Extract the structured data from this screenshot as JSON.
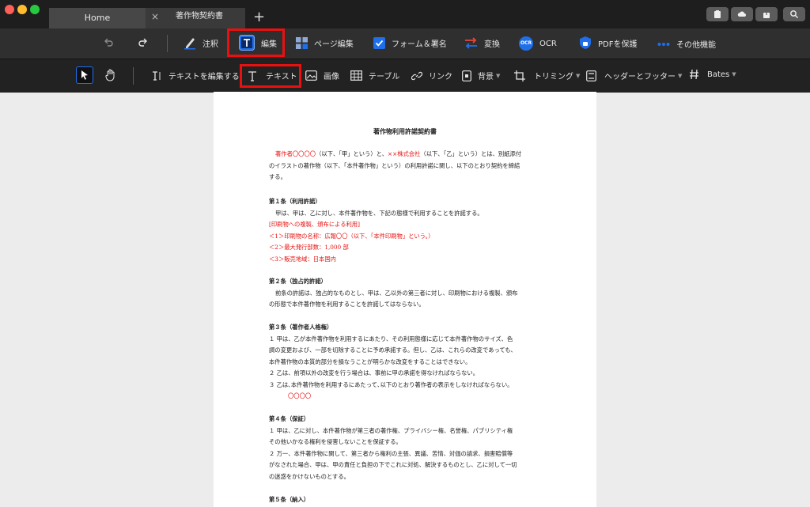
{
  "window": {
    "tabs": [
      {
        "label": "Home"
      },
      {
        "label": "著作物契約書"
      }
    ],
    "close_tab_glyph": "×",
    "add_tab_glyph": "+"
  },
  "main_toolbar": {
    "undo": "undo-icon",
    "redo": "redo-icon",
    "items": [
      {
        "label": "注釈"
      },
      {
        "label": "編集"
      },
      {
        "label": "ページ編集"
      },
      {
        "label": "フォーム＆署名"
      },
      {
        "label": "変換"
      },
      {
        "label": "OCR"
      },
      {
        "label": "PDFを保護"
      },
      {
        "label": "その他機能"
      }
    ],
    "ocr_badge": "OCR"
  },
  "edit_toolbar": {
    "items": [
      {
        "label": "テキストを編集する"
      },
      {
        "label": "テキスト"
      },
      {
        "label": "画像"
      },
      {
        "label": "テーブル"
      },
      {
        "label": "リンク"
      },
      {
        "label": "背景"
      },
      {
        "label": "トリミング"
      },
      {
        "label": "ヘッダーとフッター"
      },
      {
        "label": "Bates"
      }
    ]
  },
  "colors": {
    "highlight": "#e8110f",
    "accent_blue": "#1f6feb"
  },
  "document": {
    "title": "著作物利用許諾契約書",
    "intro": {
      "l1_a": "著作者〇〇〇〇",
      "l1_b": "（以下、「甲」という）と、",
      "l1_c": "××株式会社",
      "l1_d": "（以下、「乙」という）とは、別紙添付",
      "l2": "のイラストの著作物（以下、「本件著作物」という）の利用許諾に関し、以下のとおり契約を締結",
      "l3": "する。"
    },
    "art1": {
      "heading": "第１条（利用許諾）",
      "l1": "甲は、甲は、乙に対し、本件著作物を、下記の態様で利用することを許諾する。",
      "l2": "[印刷物への複製、頒布による利用]",
      "l3": "＜1＞印刷物の名称：広報〇〇（以下、「本件印刷物」という。）",
      "l4": "＜2＞最大発行部数：1,000 部",
      "l5": "＜3＞販売地域：日本国内"
    },
    "art2": {
      "heading": "第２条（独占的許諾）",
      "l1": "前条の許諾は、独占的なものとし、甲は、乙以外の第三者に対し、印刷物における複製、頒布",
      "l2": "の形態で本件著作物を利用することを許諾してはならない。"
    },
    "art3": {
      "heading": "第３条（著作者人格権）",
      "l1": "１ 甲は、乙が本件著作物を利用するにあたり、その利用態様に応じて本件著作物のサイズ、色",
      "l2": "調の変更および、一部を切除することに予め承諾する。但し、乙は、これらの改変であっても、",
      "l3": "本件著作物の本質的部分を損なうことが明らかな改変をすることはできない。",
      "l4": "２ 乙は、前項以外の改変を行う場合は、事前に甲の承諾を得なければならない。",
      "l5": "３ 乙は､本件著作物を利用するにあたって､以下のとおり著作者の表示をしなければならない。",
      "l6": "〇〇〇〇"
    },
    "art4": {
      "heading": "第４条（保証）",
      "l1": "１ 甲は、乙に対し、本件著作物が第三者の著作権、プライバシー権、名誉権、パブリシティ権",
      "l2": "その他いかなる権利を侵害しないことを保証する。",
      "l3": "２ 万一、本件著作物に関して、第三者から権利の主張、異議、苦情、対価の請求、損害賠償等",
      "l4": "がなされた場合、甲は、甲の責任と負担の下でこれに対処、解決するものとし、乙に対して一切",
      "l5": "の迷惑をかけないものとする。"
    },
    "art5": {
      "heading": "第５条（納入）"
    }
  }
}
